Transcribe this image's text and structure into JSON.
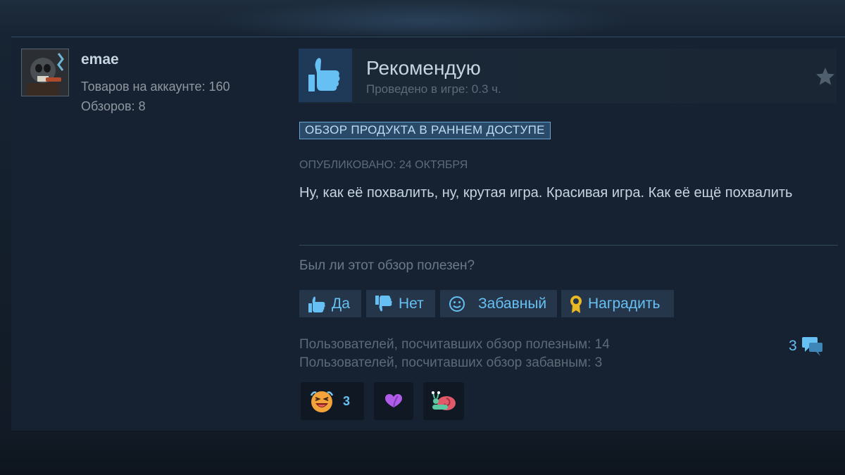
{
  "user": {
    "name": "emae",
    "products_label": "Товаров на аккаунте: 160",
    "reviews_label": "Обзоров: 8"
  },
  "review": {
    "verdict": "Рекомендую",
    "hours": "Проведено в игре: 0.3 ч.",
    "early_access_badge": "ОБЗОР ПРОДУКТА В РАННЕМ ДОСТУПЕ",
    "posted": "ОПУБЛИКОВАНО: 24 ОКТЯБРЯ",
    "text": "Ну, как её похвалить, ну, крутая игра. Красивая игра. Как её ещё похвалить"
  },
  "feedback": {
    "question": "Был ли этот обзор полезен?",
    "yes_label": "Да",
    "no_label": "Нет",
    "funny_label": "Забавный",
    "award_label": "Наградить"
  },
  "stats": {
    "helpful_text": "Пользователей, посчитавших обзор полезным: 14",
    "funny_text": "Пользователей, посчитавших обзор забавным: 3",
    "comments_count": "3"
  },
  "reactions": [
    {
      "icon": "laughing-face-icon",
      "count": "3"
    },
    {
      "icon": "purple-heart-icon",
      "count": ""
    },
    {
      "icon": "snail-icon",
      "count": ""
    }
  ],
  "colors": {
    "accent": "#66c0f4",
    "card_bg": "#162231",
    "text_primary": "#c6d4df",
    "text_muted": "#5b6b78"
  }
}
